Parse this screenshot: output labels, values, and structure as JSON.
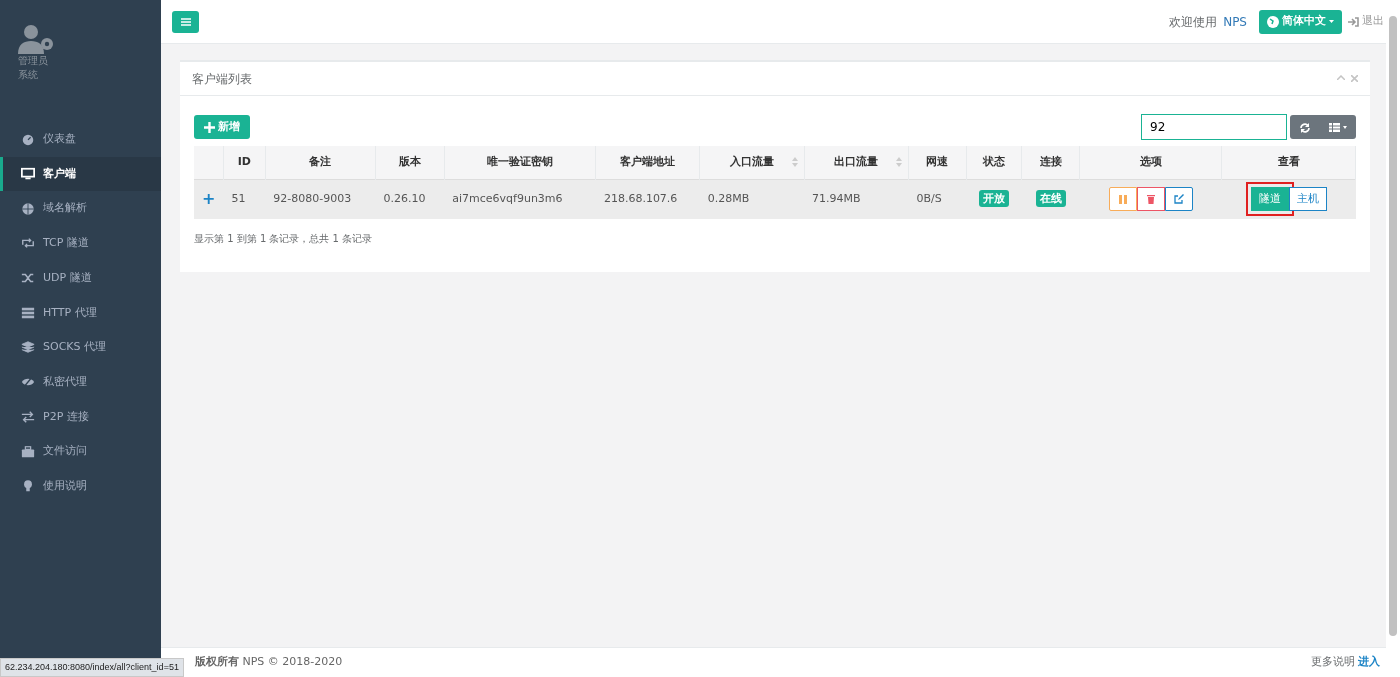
{
  "sidebar": {
    "user": {
      "role": "管理员",
      "group": "系统"
    },
    "items": [
      {
        "label": "仪表盘",
        "selected": false
      },
      {
        "label": "客户端",
        "selected": true
      },
      {
        "label": "域名解析",
        "selected": false
      },
      {
        "label": "TCP 隧道",
        "selected": false
      },
      {
        "label": "UDP 隧道",
        "selected": false
      },
      {
        "label": "HTTP 代理",
        "selected": false
      },
      {
        "label": "SOCKS 代理",
        "selected": false
      },
      {
        "label": "私密代理",
        "selected": false
      },
      {
        "label": "P2P 连接",
        "selected": false
      },
      {
        "label": "文件访问",
        "selected": false
      },
      {
        "label": "使用说明",
        "selected": false
      }
    ]
  },
  "topbar": {
    "welcome": "欢迎使用",
    "brand": "NPS",
    "language": "简体中文",
    "logout": "退出"
  },
  "panel": {
    "title": "客户端列表",
    "add_button": "新增",
    "search": {
      "value": "92"
    },
    "table": {
      "columns": [
        {
          "sortable": false
        },
        {
          "label": "ID",
          "sortable": false
        },
        {
          "label": "备注",
          "sortable": false
        },
        {
          "label": "版本",
          "sortable": false
        },
        {
          "label": "唯一验证密钥",
          "sortable": false
        },
        {
          "label": "客户端地址",
          "sortable": false
        },
        {
          "label": "入口流量",
          "sortable": true
        },
        {
          "label": "出口流量",
          "sortable": true
        },
        {
          "label": "网速",
          "sortable": false
        },
        {
          "label": "状态",
          "sortable": false
        },
        {
          "label": "连接",
          "sortable": false
        },
        {
          "label": "选项",
          "sortable": false
        },
        {
          "label": "查看",
          "sortable": false
        }
      ],
      "rows": [
        {
          "expand": "+",
          "id": "51",
          "remark": "92-8080-9003",
          "version": "0.26.10",
          "key": "ai7mce6vqf9un3m6",
          "address": "218.68.107.6",
          "in_flow": "0.28MB",
          "out_flow": "71.94MB",
          "speed": "0B/S",
          "status": "开放",
          "connection": "在线",
          "view_buttons": [
            {
              "label": "隧道",
              "highlighted": true
            },
            {
              "label": "主机",
              "highlighted": false
            }
          ]
        }
      ]
    },
    "pagination_info": "显示第 1 到第 1 条记录，总共 1 条记录"
  },
  "footer": {
    "copyright": "**版权所有** NPS © 2018-2020",
    "more": "更多说明",
    "link": "进入"
  },
  "browser_status_url": "62.234.204.180:8080/index/all?client_id=51"
}
